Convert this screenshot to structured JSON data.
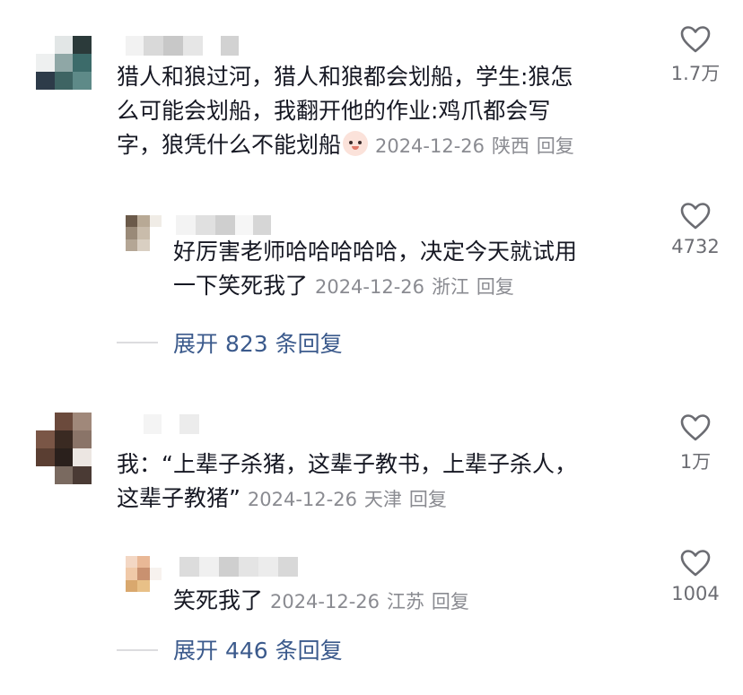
{
  "comments": [
    {
      "text": "猎人和狼过河，猎人和狼都会划船，学生:狼怎么可能会划船，我翻开他的作业:鸡爪都会写字，狼凭什么不能划船",
      "line1": "猎人和狼过河，猎人和狼都会划船，学生:狼怎",
      "line2": "么可能会划船，我翻开他的作业:鸡爪都会写",
      "line3": "字，狼凭什么不能划船",
      "emoji": "peach-face-emoji",
      "date": "2024-12-26",
      "location": "陕西",
      "reply_label": "回复",
      "likes": "1.7万",
      "replies": [
        {
          "line1": "好厉害老师哈哈哈哈哈，决定今天就试用",
          "line2": "一下笑死我了",
          "date": "2024-12-26",
          "location": "浙江",
          "reply_label": "回复",
          "likes": "4732"
        }
      ],
      "expand_label": "展开 823 条回复"
    },
    {
      "line1": "我：“上辈子杀猪，这辈子教书，上辈子杀人，",
      "line2": "这辈子教猪”",
      "date": "2024-12-26",
      "location": "天津",
      "reply_label": "回复",
      "likes": "1万",
      "replies": [
        {
          "line1": "笑死我了",
          "date": "2024-12-26",
          "location": "江苏",
          "reply_label": "回复",
          "likes": "1004"
        }
      ],
      "expand_label": "展开 446 条回复"
    }
  ],
  "colors": {
    "text": "#161823",
    "meta": "#8a8b91",
    "link": "#3b5a8c",
    "icon": "#6b6c72"
  }
}
